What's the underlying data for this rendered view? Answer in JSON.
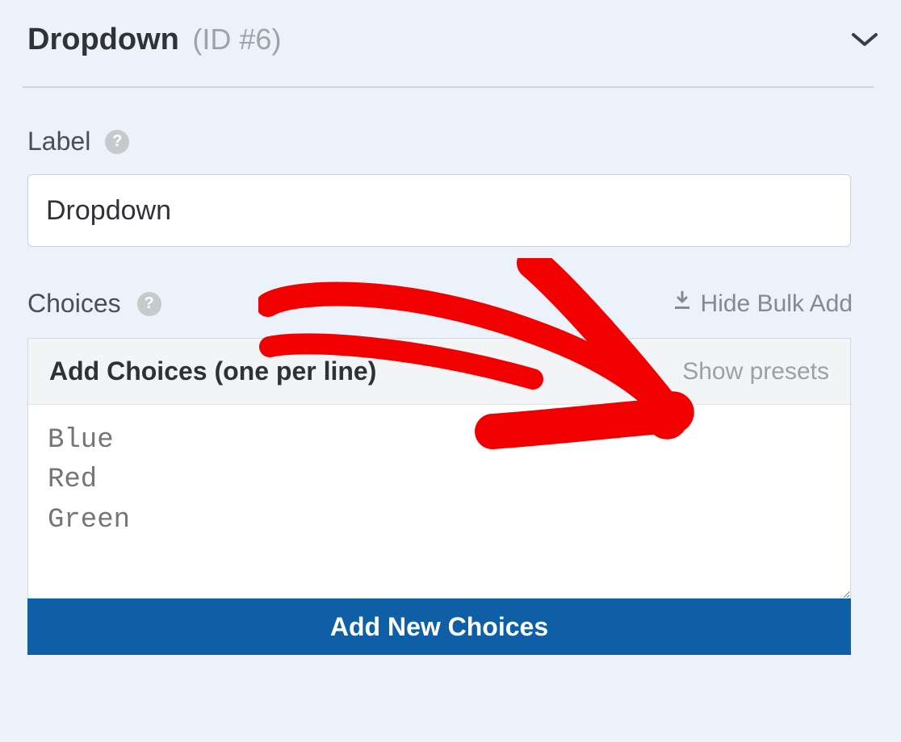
{
  "header": {
    "title": "Dropdown",
    "id": "(ID #6)"
  },
  "labelSection": {
    "label": "Label",
    "value": "Dropdown"
  },
  "choicesSection": {
    "label": "Choices",
    "hideBulk": "Hide Bulk Add",
    "bulkTitle": "Add Choices (one per line)",
    "showPresets": "Show presets",
    "textareaPlaceholder": "Blue\nRed\nGreen",
    "addButton": "Add New Choices"
  },
  "icons": {
    "help": "?",
    "download": "download-icon",
    "chevron": "chevron-down-icon"
  }
}
